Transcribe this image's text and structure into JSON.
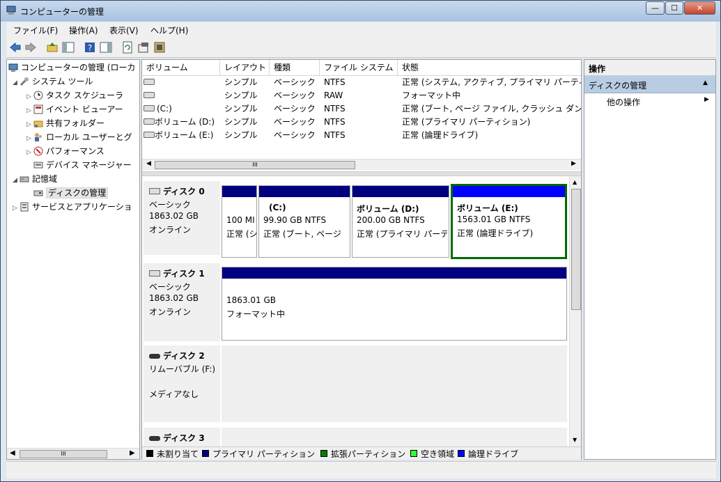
{
  "window": {
    "title": "コンピューターの管理",
    "min": "—",
    "max": "☐",
    "close": "✕"
  },
  "menu": [
    "ファイル(F)",
    "操作(A)",
    "表示(V)",
    "ヘルプ(H)"
  ],
  "tree": {
    "items": [
      {
        "label": "コンピューターの管理 (ローカ",
        "twisty": ""
      },
      {
        "label": "システム ツール",
        "twisty": "◢"
      },
      {
        "label": "タスク スケジューラ",
        "twisty": "▷"
      },
      {
        "label": "イベント ビューアー",
        "twisty": "▷"
      },
      {
        "label": "共有フォルダー",
        "twisty": "▷"
      },
      {
        "label": "ローカル ユーザーとグ",
        "twisty": "▷"
      },
      {
        "label": "パフォーマンス",
        "twisty": "▷"
      },
      {
        "label": "デバイス マネージャー",
        "twisty": ""
      },
      {
        "label": "記憶域",
        "twisty": "◢"
      },
      {
        "label": "ディスクの管理",
        "twisty": ""
      },
      {
        "label": "サービスとアプリケーショ",
        "twisty": "▷"
      }
    ],
    "scroll_label": "III"
  },
  "volumes": {
    "columns": [
      "ボリューム",
      "レイアウト",
      "種類",
      "ファイル システム",
      "状態"
    ],
    "rows": [
      {
        "vol": "",
        "layout": "シンプル",
        "type": "ベーシック",
        "fs": "NTFS",
        "status": "正常 (システム, アクティブ, プライマリ パーティ"
      },
      {
        "vol": "",
        "layout": "シンプル",
        "type": "ベーシック",
        "fs": "RAW",
        "status": "フォーマット中"
      },
      {
        "vol": "(C:)",
        "layout": "シンプル",
        "type": "ベーシック",
        "fs": "NTFS",
        "status": "正常 (ブート, ページ ファイル, クラッシュ ダン"
      },
      {
        "vol": "ボリューム (D:)",
        "layout": "シンプル",
        "type": "ベーシック",
        "fs": "NTFS",
        "status": "正常 (プライマリ パーティション)"
      },
      {
        "vol": "ボリューム (E:)",
        "layout": "シンプル",
        "type": "ベーシック",
        "fs": "NTFS",
        "status": "正常 (論理ドライブ)"
      }
    ],
    "scroll_label": "III"
  },
  "disks": [
    {
      "name": "ディスク 0",
      "type": "ベーシック",
      "size": "1863.02 GB",
      "state": "オンライン",
      "parts": [
        {
          "name": "",
          "size": "100 MI",
          "status": "正常 (シ"
        },
        {
          "name": "(C:)",
          "size": "99.90 GB NTFS",
          "status": "正常 (ブート, ページ"
        },
        {
          "name": "ボリューム  (D:)",
          "size": "200.00 GB NTFS",
          "status": "正常 (プライマリ パーテ"
        },
        {
          "name": "ボリューム  (E:)",
          "size": "1563.01 GB NTFS",
          "status": "正常 (論理ドライブ)"
        }
      ]
    },
    {
      "name": "ディスク 1",
      "type": "ベーシック",
      "size": "1863.02 GB",
      "state": "オンライン",
      "parts": [
        {
          "name": "",
          "size": "1863.01 GB",
          "status": "フォーマット中"
        }
      ]
    },
    {
      "name": "ディスク 2",
      "type": "リムーバブル (F:)",
      "size": "",
      "state": "メディアなし",
      "parts": []
    },
    {
      "name": "ディスク 3",
      "type": "",
      "size": "",
      "state": "",
      "parts": []
    }
  ],
  "legend": [
    {
      "label": "未割り当て",
      "color": "#000000"
    },
    {
      "label": "プライマリ パーティション",
      "color": "#000080"
    },
    {
      "label": "拡張パーティション",
      "color": "#008000"
    },
    {
      "label": "空き領域",
      "color": "#33ff33"
    },
    {
      "label": "論理ドライブ",
      "color": "#0000ff"
    }
  ],
  "actions": {
    "header": "操作",
    "section": "ディスクの管理",
    "item": "他の操作"
  },
  "colors": {
    "primary": "#000080",
    "logical": "#0000ff",
    "extended": "#006a00",
    "selection_header": "#b8cce4"
  }
}
